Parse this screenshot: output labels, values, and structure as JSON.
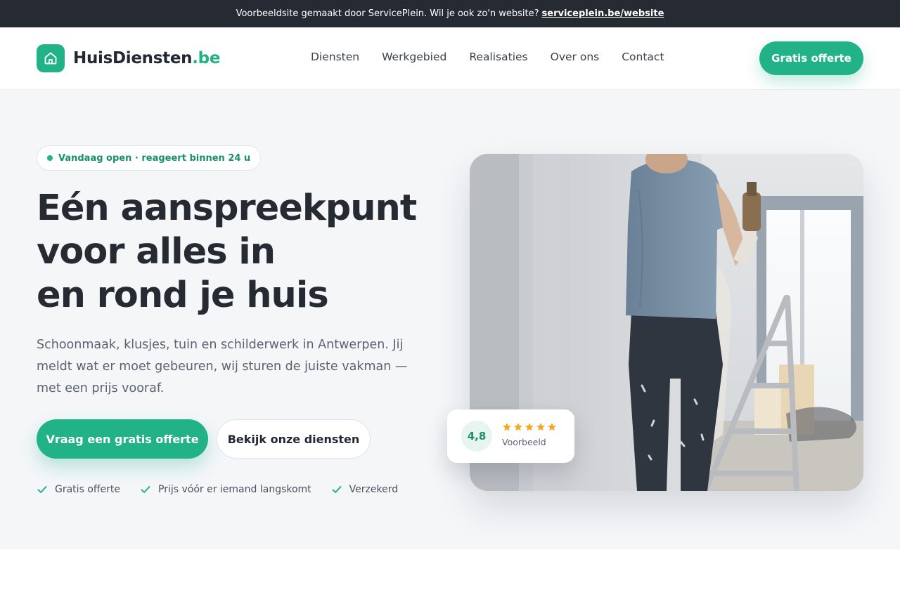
{
  "announcement": {
    "text": "Voorbeeldsite gemaakt door ServicePlein. Wil je ook zo'n website?",
    "link": "serviceplein.be/website"
  },
  "header": {
    "logo_name": "HuisDiensten",
    "logo_tld": ".be",
    "nav": [
      "Diensten",
      "Werkgebied",
      "Realisaties",
      "Over ons",
      "Contact"
    ],
    "cta": "Gratis offerte"
  },
  "hero": {
    "badge": "Vandaag open · reageert binnen 24 u",
    "headline": [
      "Eén aanspreekpunt",
      "voor alles in",
      "en rond je huis"
    ],
    "lead": "Schoonmaak, klusjes, tuin en schilderwerk in Antwerpen. Jij meldt wat er moet gebeuren, wij sturen de juiste vakman — met een prijs vooraf.",
    "primary_button": "Vraag een gratis offerte",
    "secondary_button": "Bekijk onze diensten",
    "checks": [
      "Gratis offerte",
      "Prijs vóór er iemand langskomt",
      "Verzekerd"
    ]
  },
  "rating": {
    "score": "4,8",
    "stars": 5,
    "label": "Voorbeeld"
  },
  "colors": {
    "accent": "#22b287",
    "dark": "#262b33",
    "hero_bg": "#f4f6f8",
    "star": "#f5a623"
  },
  "icons": {
    "logo": "house-icon",
    "check": "check-icon",
    "star": "star-icon"
  }
}
